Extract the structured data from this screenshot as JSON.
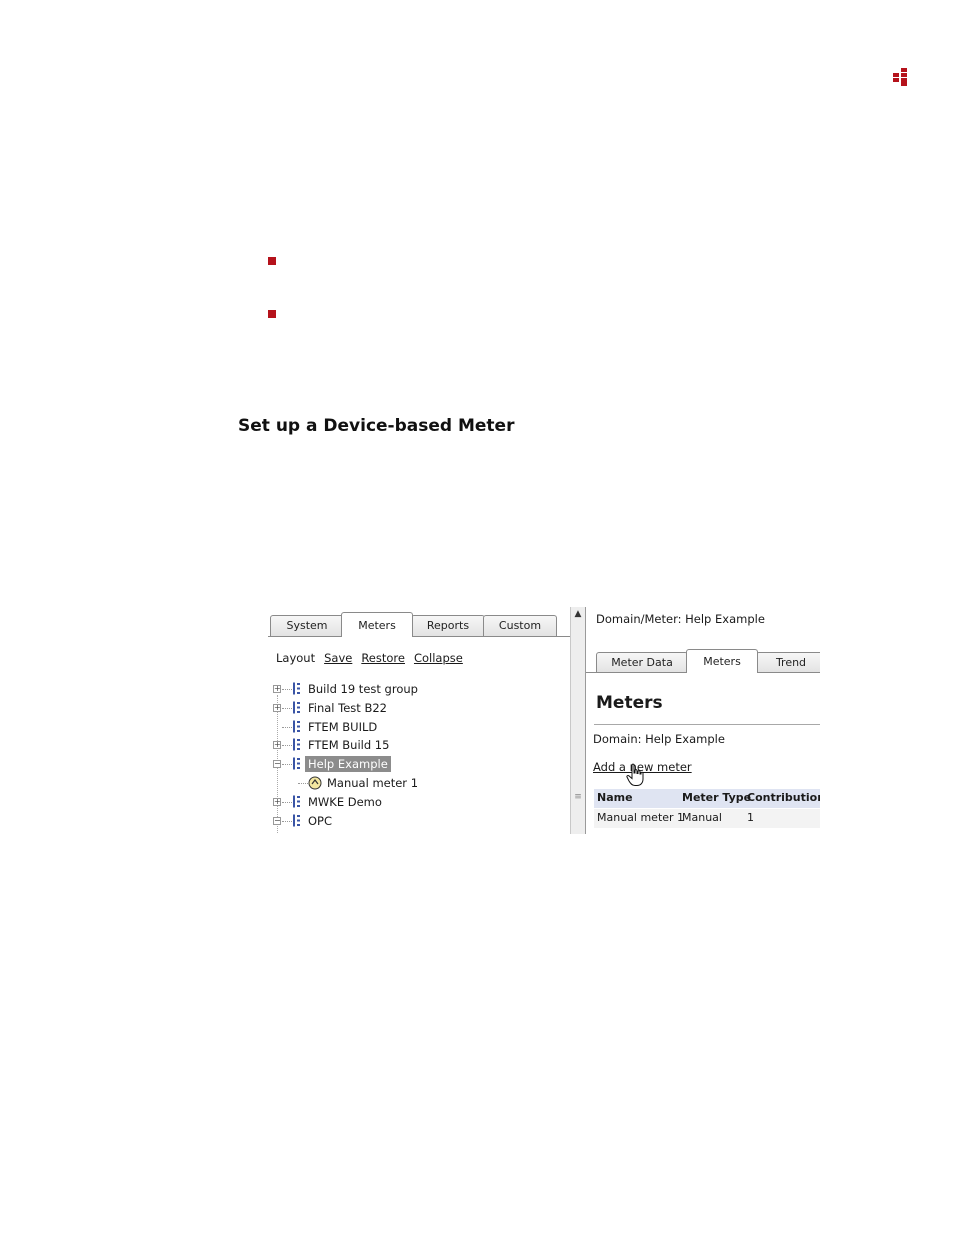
{
  "colors": {
    "accent": "#b5121b",
    "selection": "#8c8c8c",
    "grid_header": "#dfe4f2"
  },
  "page": {
    "logo_icon": "brand-logo-icon",
    "bullets": [
      "square-bullet",
      "square-bullet"
    ],
    "heading": "Set up a Device-based Meter"
  },
  "screenshot": {
    "left_tabs": [
      "System",
      "Meters",
      "Reports",
      "Custom"
    ],
    "active_left_tab": "Meters",
    "layout_bar": {
      "label": "Layout",
      "links": [
        "Save",
        "Restore",
        "Collapse"
      ]
    },
    "tree": [
      {
        "label": "Build 19 test group",
        "expander": "+",
        "icon": "meter-group-icon"
      },
      {
        "label": "Final Test B22",
        "expander": "+",
        "icon": "meter-group-icon"
      },
      {
        "label": "FTEM BUILD",
        "expander": "",
        "icon": "meter-group-icon"
      },
      {
        "label": "FTEM Build 15",
        "expander": "+",
        "icon": "meter-group-icon"
      },
      {
        "label": "Help Example",
        "expander": "−",
        "icon": "meter-group-icon",
        "selected": true
      },
      {
        "label": "Manual meter 1",
        "expander": "",
        "icon": "manual-meter-icon",
        "child": true
      },
      {
        "label": "MWKE Demo",
        "expander": "+",
        "icon": "meter-group-icon"
      },
      {
        "label": "OPC",
        "expander": "−",
        "icon": "meter-group-icon"
      }
    ],
    "breadcrumb": "Domain/Meter: Help Example",
    "right_tabs": [
      "Meter Data",
      "Meters",
      "Trend"
    ],
    "active_right_tab": "Meters",
    "section_title": "Meters",
    "domain_line": "Domain: Help Example",
    "add_link": "Add a new meter",
    "grid": {
      "columns": [
        "Name",
        "Meter Type",
        "Contribution F"
      ],
      "rows": [
        [
          "Manual meter 1",
          "Manual",
          "1"
        ]
      ]
    }
  }
}
